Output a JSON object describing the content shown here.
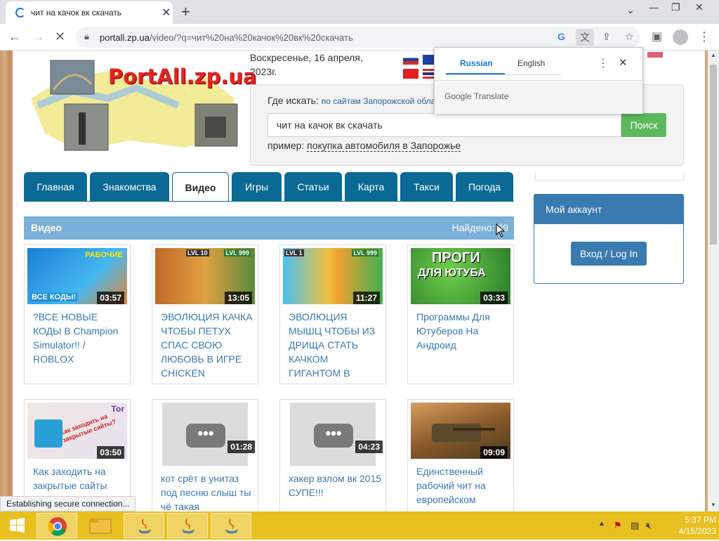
{
  "browser": {
    "tab_title": "чит на качок вк скачать",
    "url_host": "portall.zp.ua",
    "url_path": "/video/?q=чит%20на%20качок%20вк%20скачать"
  },
  "translate_popup": {
    "lang_from": "Russian",
    "lang_to": "English",
    "brand_google": "Google",
    "brand_translate": "Translate"
  },
  "header": {
    "logo_text": "PortAll.zp.ua",
    "date_line1": "Воскресенье, 16 апреля,",
    "date_line2": "2023г."
  },
  "search": {
    "where_label": "Где искать:",
    "where_value": "по сайтам Запорожской обла",
    "query": "чит на качок вк скачать",
    "button": "Поиск",
    "example_label": "пример:",
    "example_link": "покупка автомобиля в Запорожье"
  },
  "nav": {
    "tabs": [
      "Главная",
      "Знакомства",
      "Видео",
      "Игры",
      "Статьи",
      "Карта",
      "Такси",
      "Погода"
    ],
    "active": "Видео"
  },
  "video_section": {
    "title": "Видео",
    "found": "Найдено: 99"
  },
  "videos": [
    {
      "title": "?ВСЕ НОВЫЕ КОДЫ В Champion Simulator!! / ROBLOX",
      "duration": "03:57",
      "thumb_text": "РАБОЧИЕ",
      "thumb_text2": "ВСЕ КОДЫ!"
    },
    {
      "title": "ЭВОЛЮЦИЯ КАЧКА ЧТОБЫ ПЕТУХ СПАС СВОЮ ЛЮБОВЬ В ИГРЕ CHICKEN",
      "duration": "13:05",
      "thumb_text": "LVL 10",
      "thumb_text2": "LVL 999"
    },
    {
      "title": "ЭВОЛЮЦИЯ МЫШЦ ЧТОБЫ ИЗ ДРИЩА СТАТЬ КАЧКОМ ГИГАНТОМ В",
      "duration": "11:27",
      "thumb_text": "LVL 1",
      "thumb_text2": "LVL 999"
    },
    {
      "title": "Программы Для Ютуберов На Андроид",
      "duration": "03:33",
      "thumb_text": "ПРОГИ",
      "thumb_text2": "ДЛЯ ЮТУБА"
    },
    {
      "title": "Как заходить на закрытые сайты",
      "duration": "03:50",
      "thumb_text": "Как заходить на закрытые сайты?",
      "thumb_text2": "Tor"
    },
    {
      "title": "кот срёт в унитаз под песню слыш ты чё такая",
      "duration": "01:28",
      "thumb_text": "•••",
      "thumb_text2": ""
    },
    {
      "title": "хакер взлом вк 2015 СУПЕ!!!",
      "duration": "04:23",
      "thumb_text": "•••",
      "thumb_text2": ""
    },
    {
      "title": "Единственный рабочий чит на европейском",
      "duration": "09:09",
      "thumb_text": "",
      "thumb_text2": ""
    }
  ],
  "account": {
    "title": "Мой аккаунт",
    "login_button": "Вход / Log In"
  },
  "status_bar": "Establishing secure connection...",
  "taskbar": {
    "time": "5:37 PM",
    "date": "4/15/2023"
  },
  "colors": {
    "nav_tab": "#0a6a95",
    "section_header": "#7ab0d8",
    "search_button": "#5cb85c",
    "taskbar": "#e8c020",
    "link": "#3a7ab0"
  }
}
